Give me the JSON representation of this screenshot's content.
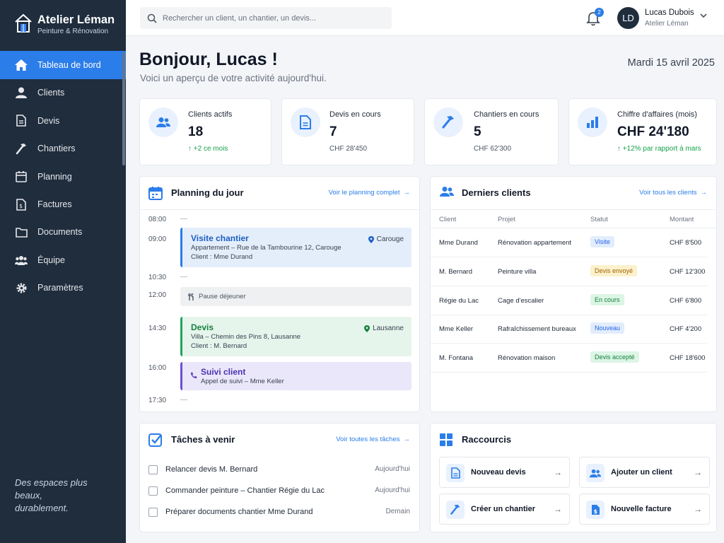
{
  "brand": {
    "name": "Atelier Léman",
    "subtitle": "Peinture & Rénovation"
  },
  "sidebar": {
    "items": [
      {
        "label": "Tableau de bord",
        "icon": "home-icon",
        "active": true
      },
      {
        "label": "Clients",
        "icon": "user-icon"
      },
      {
        "label": "Devis",
        "icon": "document-icon"
      },
      {
        "label": "Chantiers",
        "icon": "hammer-icon"
      },
      {
        "label": "Planning",
        "icon": "calendar-icon"
      },
      {
        "label": "Factures",
        "icon": "invoice-icon"
      },
      {
        "label": "Documents",
        "icon": "folder-icon"
      },
      {
        "label": "Équipe",
        "icon": "team-icon"
      },
      {
        "label": "Paramètres",
        "icon": "gear-icon"
      }
    ],
    "tagline": "Des espaces plus beaux, durablement."
  },
  "topbar": {
    "search_placeholder": "Rechercher un client, un chantier, un devis...",
    "notification_count": "2",
    "user": {
      "initials": "LD",
      "name": "Lucas Dubois",
      "role": "Atelier Léman"
    }
  },
  "header": {
    "greeting": "Bonjour, Lucas !",
    "subtitle": "Voici un aperçu de votre activité aujourd'hui.",
    "date": "Mardi 15 avril 2025"
  },
  "stats": [
    {
      "label": "Clients actifs",
      "value": "18",
      "sub": "↑ +2 ce mois",
      "icon": "users-icon"
    },
    {
      "label": "Devis en cours",
      "value": "7",
      "sub": "CHF 28'450",
      "icon": "document-icon"
    },
    {
      "label": "Chantiers en cours",
      "value": "5",
      "sub": "CHF 62'300",
      "icon": "hammer-icon"
    },
    {
      "label": "Chiffre d'affaires (mois)",
      "value": "CHF 24'180",
      "sub": "↑ +12% par rapport à mars",
      "icon": "bar-chart-icon"
    }
  ],
  "planning": {
    "title": "Planning du jour",
    "link": "Voir le planning complet",
    "times": [
      "08:00",
      "09:00",
      "10:30",
      "12:00",
      "14:30",
      "16:00",
      "17:30"
    ],
    "events": [
      {
        "title": "Visite chantier",
        "line1": "Appartement – Rue de la Tambourine 12, Carouge",
        "line2": "Client : Mme Durand",
        "location": "Carouge"
      },
      {
        "title": "Pause déjeuner"
      },
      {
        "title": "Devis",
        "line1": "Villa – Chemin des Pins 8, Lausanne",
        "line2": "Client : M. Bernard",
        "location": "Lausanne"
      },
      {
        "title": "Suivi client",
        "line1": "Appel de suivi – Mme Keller"
      }
    ]
  },
  "clients": {
    "title": "Derniers clients",
    "link": "Voir tous les clients",
    "headers": [
      "Client",
      "Projet",
      "Statut",
      "Montant"
    ],
    "rows": [
      {
        "client": "Mme Durand",
        "project": "Rénovation appartement",
        "status": "Visite",
        "amount": "CHF 8'500"
      },
      {
        "client": "M. Bernard",
        "project": "Peinture villa",
        "status": "Devis envoyé",
        "amount": "CHF 12'300"
      },
      {
        "client": "Régie du Lac",
        "project": "Cage d'escalier",
        "status": "En cours",
        "amount": "CHF 6'800"
      },
      {
        "client": "Mme Keller",
        "project": "Rafraîchissement bureaux",
        "status": "Nouveau",
        "amount": "CHF 4'200"
      },
      {
        "client": "M. Fontana",
        "project": "Rénovation maison",
        "status": "Devis accepté",
        "amount": "CHF 18'600"
      }
    ]
  },
  "tasks": {
    "title": "Tâches à venir",
    "link": "Voir toutes les tâches",
    "items": [
      {
        "label": "Relancer devis M. Bernard",
        "due": "Aujourd'hui"
      },
      {
        "label": "Commander peinture – Chantier Régie du Lac",
        "due": "Aujourd'hui"
      },
      {
        "label": "Préparer documents chantier Mme Durand",
        "due": "Demain"
      }
    ]
  },
  "shortcuts": {
    "title": "Raccourcis",
    "items": [
      {
        "label": "Nouveau devis",
        "icon": "document-icon"
      },
      {
        "label": "Ajouter un client",
        "icon": "users-icon"
      },
      {
        "label": "Créer un chantier",
        "icon": "hammer-icon"
      },
      {
        "label": "Nouvelle facture",
        "icon": "invoice-icon"
      }
    ]
  },
  "colors": {
    "accent": "#2b7de9",
    "sidebar": "#1f2d3d",
    "success": "#16a34a"
  }
}
